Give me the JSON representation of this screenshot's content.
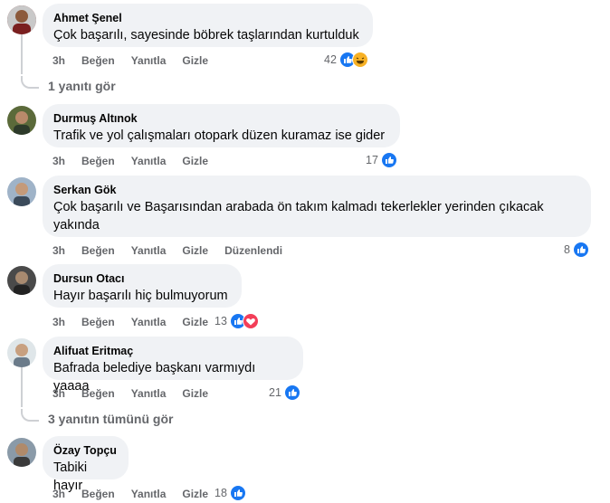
{
  "comments": [
    {
      "name": "Ahmet Şenel",
      "text": "Çok başarılı, sayesinde böbrek taşlarından kurtulduk",
      "time": "3h",
      "like": "Beğen",
      "reply": "Yanıtla",
      "hide": "Gizle",
      "count": "42",
      "reactions": [
        "like",
        "haha"
      ]
    },
    {
      "name": "Durmuş Altınok",
      "text": "Trafik ve yol çalışmaları otopark düzen kuramaz ise gider",
      "time": "3h",
      "like": "Beğen",
      "reply": "Yanıtla",
      "hide": "Gizle",
      "count": "17",
      "reactions": [
        "like"
      ]
    },
    {
      "name": "Serkan Gök",
      "text": "Çok başarılı ve Başarısından arabada ön takım kalmadı tekerlekler yerinden çıkacak yakında",
      "time": "3h",
      "like": "Beğen",
      "reply": "Yanıtla",
      "hide": "Gizle",
      "edited": "Düzenlendi",
      "count": "8",
      "reactions": [
        "like"
      ]
    },
    {
      "name": "Dursun Otacı",
      "text": "Hayır başarılı hiç bulmuyorum",
      "time": "3h",
      "like": "Beğen",
      "reply": "Yanıtla",
      "hide": "Gizle",
      "count": "13",
      "reactions": [
        "like",
        "love"
      ]
    },
    {
      "name": "Alifuat Eritmaç",
      "text": "Bafrada belediye başkanı varmıydı yaaaa",
      "time": "3h",
      "like": "Beğen",
      "reply": "Yanıtla",
      "hide": "Gizle",
      "count": "21",
      "reactions": [
        "like"
      ]
    },
    {
      "name": "Özay Topçu",
      "text": "Tabiki hayır",
      "time": "3h",
      "like": "Beğen",
      "reply": "Yanıtla",
      "hide": "Gizle",
      "count": "18",
      "reactions": [
        "like"
      ]
    }
  ],
  "reply_links": {
    "first": "1 yanıtı gör",
    "second": "3 yanıtın tümünü gör"
  },
  "colors": {
    "bubble": "#f0f2f5",
    "muted": "#65676b",
    "like": "#1877f2",
    "haha": "#f7b125",
    "love": "#f33e58"
  },
  "icons": [
    "like-reaction-icon",
    "haha-reaction-icon",
    "love-reaction-icon"
  ]
}
